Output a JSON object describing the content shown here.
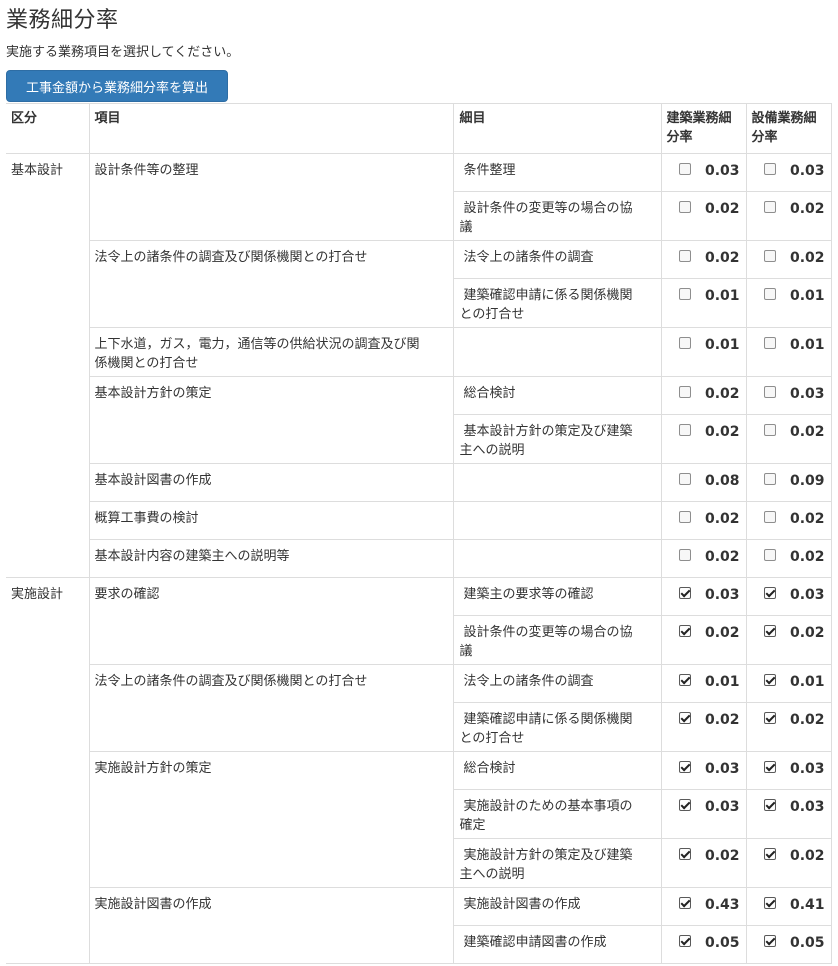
{
  "page": {
    "title": "業務細分率",
    "description": "実施する業務項目を選択してください。",
    "calc_button": "工事金額から業務細分率を算出"
  },
  "table": {
    "headers": {
      "kubun": "区分",
      "item": "項目",
      "detail": "細目",
      "arch_line1": "建築業務細",
      "arch_line2": "分率",
      "equip_line1": "設備業務細",
      "equip_line2": "分率"
    },
    "sections": [
      {
        "kubun": "基本設計",
        "items": [
          {
            "name": "設計条件等の整理",
            "details": [
              {
                "label_1": "条件整理",
                "label_2": "",
                "arch_checked": false,
                "arch": "0.03",
                "equip_checked": false,
                "equip": "0.03"
              },
              {
                "label_1": "設計条件の変更等の場合の協",
                "label_2": "議",
                "arch_checked": false,
                "arch": "0.02",
                "equip_checked": false,
                "equip": "0.02"
              }
            ]
          },
          {
            "name": "法令上の諸条件の調査及び関係機関との打合せ",
            "details": [
              {
                "label_1": "法令上の諸条件の調査",
                "label_2": "",
                "arch_checked": false,
                "arch": "0.02",
                "equip_checked": false,
                "equip": "0.02"
              },
              {
                "label_1": "建築確認申請に係る関係機関",
                "label_2": "との打合せ",
                "arch_checked": false,
                "arch": "0.01",
                "equip_checked": false,
                "equip": "0.01"
              }
            ]
          },
          {
            "name_1": "上下水道，ガス，電力，通信等の供給状況の調査及び関",
            "name_2": "係機関との打合せ",
            "details": [
              {
                "label_1": "",
                "label_2": "",
                "arch_checked": false,
                "arch": "0.01",
                "equip_checked": false,
                "equip": "0.01"
              }
            ]
          },
          {
            "name": "基本設計方針の策定",
            "details": [
              {
                "label_1": "総合検討",
                "label_2": "",
                "arch_checked": false,
                "arch": "0.02",
                "equip_checked": false,
                "equip": "0.03"
              },
              {
                "label_1": "基本設計方針の策定及び建築",
                "label_2": "主への説明",
                "arch_checked": false,
                "arch": "0.02",
                "equip_checked": false,
                "equip": "0.02"
              }
            ]
          },
          {
            "name": "基本設計図書の作成",
            "details": [
              {
                "label_1": "",
                "label_2": "",
                "arch_checked": false,
                "arch": "0.08",
                "equip_checked": false,
                "equip": "0.09"
              }
            ]
          },
          {
            "name": "概算工事費の検討",
            "details": [
              {
                "label_1": "",
                "label_2": "",
                "arch_checked": false,
                "arch": "0.02",
                "equip_checked": false,
                "equip": "0.02"
              }
            ]
          },
          {
            "name": "基本設計内容の建築主への説明等",
            "details": [
              {
                "label_1": "",
                "label_2": "",
                "arch_checked": false,
                "arch": "0.02",
                "equip_checked": false,
                "equip": "0.02"
              }
            ]
          }
        ]
      },
      {
        "kubun": "実施設計",
        "items": [
          {
            "name": "要求の確認",
            "details": [
              {
                "label_1": "建築主の要求等の確認",
                "label_2": "",
                "arch_checked": true,
                "arch": "0.03",
                "equip_checked": true,
                "equip": "0.03"
              },
              {
                "label_1": "設計条件の変更等の場合の協",
                "label_2": "議",
                "arch_checked": true,
                "arch": "0.02",
                "equip_checked": true,
                "equip": "0.02"
              }
            ]
          },
          {
            "name": "法令上の諸条件の調査及び関係機関との打合せ",
            "details": [
              {
                "label_1": "法令上の諸条件の調査",
                "label_2": "",
                "arch_checked": true,
                "arch": "0.01",
                "equip_checked": true,
                "equip": "0.01"
              },
              {
                "label_1": "建築確認申請に係る関係機関",
                "label_2": "との打合せ",
                "arch_checked": true,
                "arch": "0.02",
                "equip_checked": true,
                "equip": "0.02"
              }
            ]
          },
          {
            "name": "実施設計方針の策定",
            "details": [
              {
                "label_1": "総合検討",
                "label_2": "",
                "arch_checked": true,
                "arch": "0.03",
                "equip_checked": true,
                "equip": "0.03"
              },
              {
                "label_1": "実施設計のための基本事項の",
                "label_2": "確定",
                "arch_checked": true,
                "arch": "0.03",
                "equip_checked": true,
                "equip": "0.03"
              },
              {
                "label_1": "実施設計方針の策定及び建築",
                "label_2": "主への説明",
                "arch_checked": true,
                "arch": "0.02",
                "equip_checked": true,
                "equip": "0.02"
              }
            ]
          },
          {
            "name": "実施設計図書の作成",
            "details": [
              {
                "label_1": "実施設計図書の作成",
                "label_2": "",
                "arch_checked": true,
                "arch": "0.43",
                "equip_checked": true,
                "equip": "0.41"
              },
              {
                "label_1": "建築確認申請図書の作成",
                "label_2": "",
                "arch_checked": true,
                "arch": "0.05",
                "equip_checked": true,
                "equip": "0.05"
              }
            ]
          }
        ]
      }
    ]
  }
}
